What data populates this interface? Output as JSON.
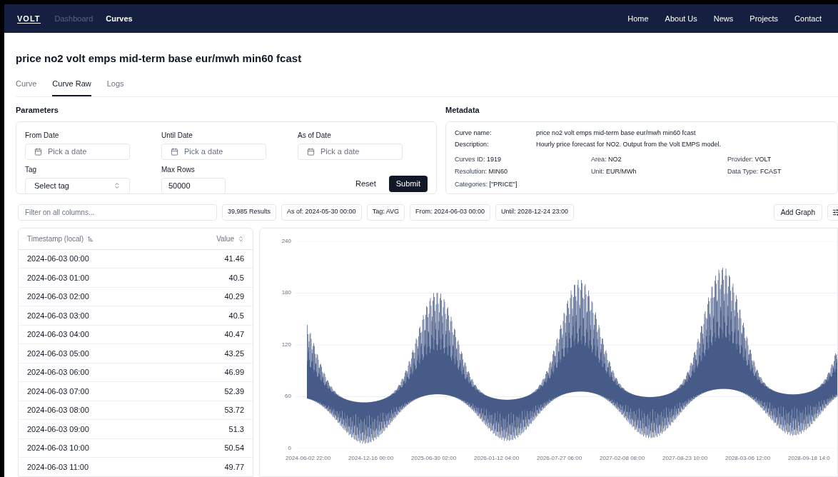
{
  "nav": {
    "logo": "VOLT",
    "links_left": [
      {
        "label": "Dashboard",
        "selected": false
      },
      {
        "label": "Curves",
        "selected": true
      }
    ],
    "links_right": [
      "Home",
      "About Us",
      "News",
      "Projects",
      "Contact"
    ]
  },
  "title": "price no2 volt emps mid-term base eur/mwh min60 fcast",
  "tabs": [
    {
      "label": "Curve",
      "selected": false
    },
    {
      "label": "Curve Raw",
      "selected": true
    },
    {
      "label": "Logs",
      "selected": false
    }
  ],
  "parameters": {
    "heading": "Parameters",
    "from_date": {
      "label": "From Date",
      "placeholder": "Pick a date"
    },
    "until_date": {
      "label": "Until Date",
      "placeholder": "Pick a date"
    },
    "as_of_date": {
      "label": "As of Date",
      "placeholder": "Pick a date"
    },
    "tag": {
      "label": "Tag",
      "value": "Select tag"
    },
    "max_rows": {
      "label": "Max Rows",
      "value": "50000"
    },
    "reset": "Reset",
    "submit": "Submit"
  },
  "metadata": {
    "heading": "Metadata",
    "curve_name": {
      "label": "Curve name:",
      "value": "price no2 volt emps mid-term base eur/mwh min60 fcast"
    },
    "description": {
      "label": "Description:",
      "value": "Hourly price forecast for NO2. Output from the Volt EMPS model."
    },
    "fields": [
      {
        "label": "Curves ID:",
        "value": "1919"
      },
      {
        "label": "Area:",
        "value": "NO2"
      },
      {
        "label": "Provider:",
        "value": "VOLT"
      },
      {
        "label": "Resolution:",
        "value": "MIN60"
      },
      {
        "label": "Unit:",
        "value": "EUR/MWh"
      },
      {
        "label": "Data Type:",
        "value": "FCAST"
      },
      {
        "label": "Categories:",
        "value": "[\"PRICE\"]"
      }
    ]
  },
  "filter": {
    "placeholder": "Filter on all columns...",
    "badges": [
      "39,985 Results",
      "As of: 2024-05-30 00:00",
      "Tag: AVG",
      "From: 2024-06-03 00:00",
      "Until: 2028-12-24 23:00"
    ],
    "add_graph": "Add Graph"
  },
  "table": {
    "columns": [
      "Timestamp (local)",
      "Value"
    ],
    "rows": [
      [
        "2024-06-03 00:00",
        "41.46"
      ],
      [
        "2024-06-03 01:00",
        "40.5"
      ],
      [
        "2024-06-03 02:00",
        "40.29"
      ],
      [
        "2024-06-03 03:00",
        "40.5"
      ],
      [
        "2024-06-03 04:00",
        "40.47"
      ],
      [
        "2024-06-03 05:00",
        "43.25"
      ],
      [
        "2024-06-03 06:00",
        "46.99"
      ],
      [
        "2024-06-03 07:00",
        "52.39"
      ],
      [
        "2024-06-03 08:00",
        "53.72"
      ],
      [
        "2024-06-03 09:00",
        "51.3"
      ],
      [
        "2024-06-03 10:00",
        "50.54"
      ],
      [
        "2024-06-03 11:00",
        "49.77"
      ]
    ]
  },
  "chart": {
    "yticks": [
      "240",
      "180",
      "120",
      "60",
      "0"
    ],
    "xticks": [
      "2024-06-02 22:00",
      "2024-12-16 00:00",
      "2025-06-30 02:00",
      "2026-01-12 04:00",
      "2026-07-27 06:00",
      "2027-02-08 08:00",
      "2027-08-23 10:00",
      "2028-03-06 12:00",
      "2028-09-18 14:0"
    ]
  }
}
